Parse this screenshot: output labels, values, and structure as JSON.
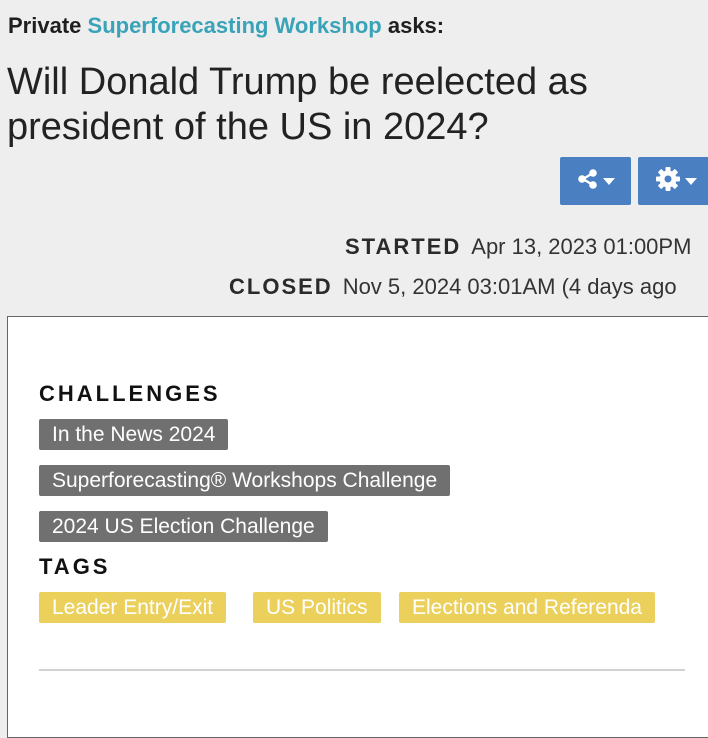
{
  "header": {
    "prefix": "Private",
    "organization": "Superforecasting Workshop",
    "suffix": "asks:"
  },
  "question": {
    "title": "Will Donald Trump be reelected as president of the US in 2024?"
  },
  "toolbar": {
    "share_icon": "share-icon",
    "settings_icon": "gear-icon"
  },
  "dates": {
    "started_label": "STARTED",
    "started_value": "Apr 13, 2023 01:00PM",
    "closed_label": "CLOSED",
    "closed_value": "Nov 5, 2024 03:01AM (4 days ago"
  },
  "challenges": {
    "heading": "CHALLENGES",
    "items": [
      "In the News 2024",
      "Superforecasting® Workshops Challenge",
      "2024 US Election Challenge"
    ]
  },
  "tags": {
    "heading": "TAGS",
    "items": [
      "Leader Entry/Exit",
      "US Politics",
      "Elections and Referenda"
    ]
  },
  "colors": {
    "link": "#3aa3b8",
    "button": "#4a7fc1",
    "chip": "#707070",
    "tag": "#ecd05c",
    "background": "#eeeeee"
  }
}
